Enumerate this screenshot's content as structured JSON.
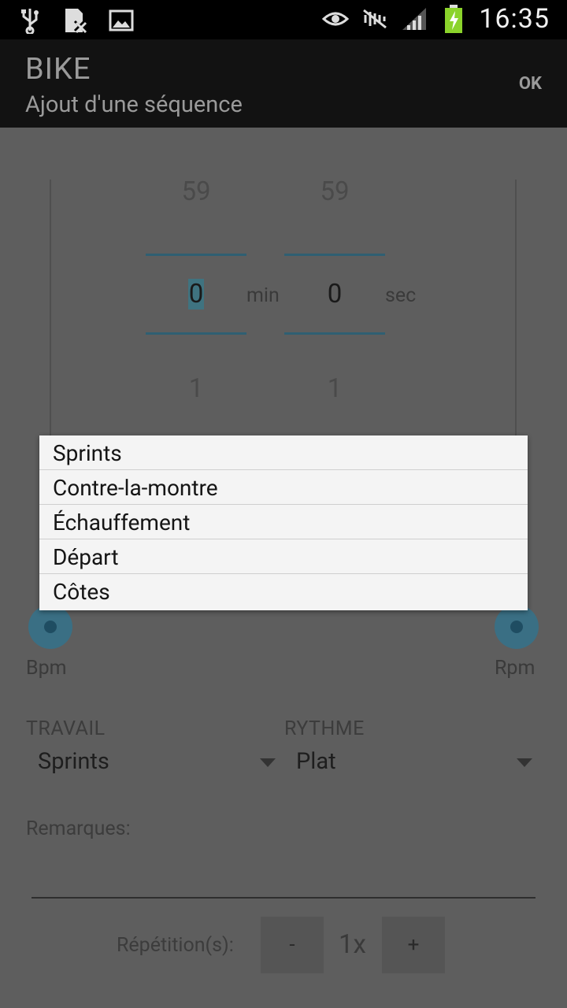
{
  "status_bar": {
    "time": "16:35",
    "icons": [
      "usb-icon",
      "sim-error-icon",
      "image-icon",
      "eye-icon",
      "mute-icon",
      "signal-icon",
      "battery-charging-icon"
    ]
  },
  "action_bar": {
    "title": "BIKE",
    "subtitle": "Ajout d'une séquence",
    "ok_label": "OK"
  },
  "duration_picker": {
    "minutes": {
      "prev": "59",
      "current": "0",
      "next": "1",
      "unit": "min"
    },
    "seconds": {
      "prev": "59",
      "current": "0",
      "next": "1",
      "unit": "sec"
    }
  },
  "sliders": {
    "bpm_label": "Bpm",
    "rpm_label": "Rpm"
  },
  "travail": {
    "label": "TRAVAIL",
    "value": "Sprints"
  },
  "rythme": {
    "label": "RYTHME",
    "value": "Plat"
  },
  "remarques": {
    "label": "Remarques:",
    "value": ""
  },
  "repetition": {
    "label": "Répétition(s):",
    "minus_label": "-",
    "value": "1x",
    "plus_label": "+"
  },
  "popup": {
    "items": [
      "Sprints",
      "Contre-la-montre",
      "Échauffement",
      "Départ",
      "Côtes"
    ]
  },
  "colors": {
    "accent": "#33b5e5",
    "battery_green": "#8bd32b"
  }
}
